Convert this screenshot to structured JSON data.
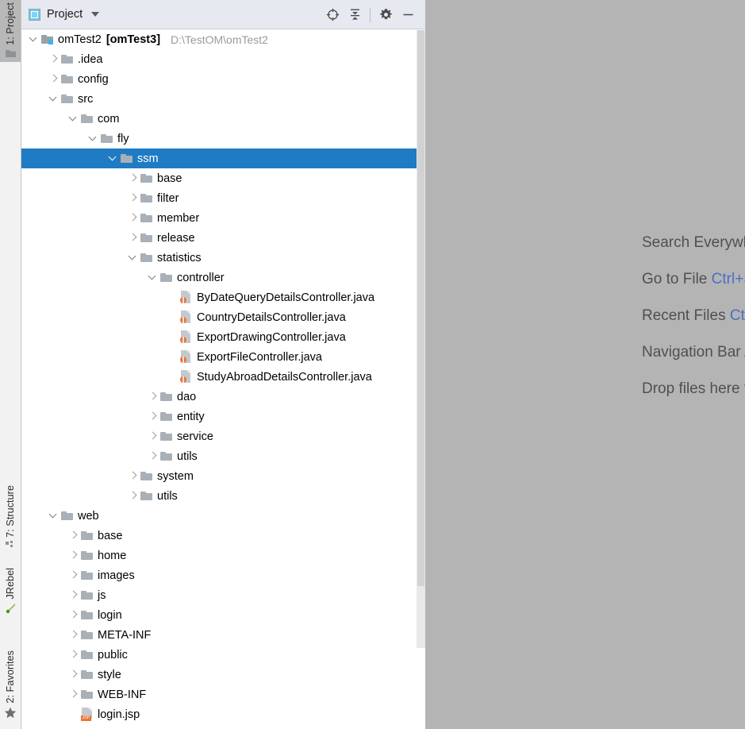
{
  "window": {
    "app": "IntelliJ IDEA",
    "background_color": "#b4b4b4"
  },
  "tool_strip": {
    "top_buttons": [
      {
        "label": "1: Project",
        "icon": "folder-icon",
        "active": true
      }
    ],
    "bottom_buttons": [
      {
        "label": "7: Structure",
        "icon": "structure-icon",
        "active": false
      },
      {
        "label": "JRebel",
        "icon": "jrebel-icon",
        "active": false
      },
      {
        "label": "2: Favorites",
        "icon": "star-icon",
        "active": false
      }
    ]
  },
  "panel": {
    "title": "Project",
    "view_icon": "project-view-icon",
    "dropdown_icon": "chevron-down-icon",
    "toolbar": [
      {
        "name": "scroll-from-source-button",
        "icon": "crosshair-icon",
        "tooltip": "Select Opened File"
      },
      {
        "name": "collapse-all-button",
        "icon": "collapse-all-icon",
        "tooltip": "Collapse All"
      },
      {
        "name": "settings-button",
        "icon": "gear-icon",
        "tooltip": "Settings"
      },
      {
        "name": "hide-button",
        "icon": "minimize-icon",
        "tooltip": "Hide"
      }
    ]
  },
  "tree": {
    "selection_color": "#1f7cc4",
    "nodes": [
      {
        "indent": 0,
        "state": "expanded",
        "icon": "module-folder-icon",
        "label": "omTest2",
        "label_bold": "[omTest3]",
        "path": "D:\\TestOM\\omTest2",
        "selected": false
      },
      {
        "indent": 1,
        "state": "collapsed",
        "icon": "folder-icon",
        "label": ".idea",
        "selected": false
      },
      {
        "indent": 1,
        "state": "collapsed",
        "icon": "folder-icon",
        "label": "config",
        "selected": false
      },
      {
        "indent": 1,
        "state": "expanded",
        "icon": "folder-icon",
        "label": "src",
        "selected": false
      },
      {
        "indent": 2,
        "state": "expanded",
        "icon": "folder-icon",
        "label": "com",
        "selected": false
      },
      {
        "indent": 3,
        "state": "expanded",
        "icon": "folder-icon",
        "label": "fly",
        "selected": false
      },
      {
        "indent": 4,
        "state": "expanded",
        "icon": "folder-icon",
        "label": "ssm",
        "selected": true
      },
      {
        "indent": 5,
        "state": "collapsed",
        "icon": "folder-icon",
        "label": "base",
        "selected": false
      },
      {
        "indent": 5,
        "state": "collapsed",
        "icon": "folder-icon",
        "label": "filter",
        "selected": false
      },
      {
        "indent": 5,
        "state": "collapsed",
        "icon": "folder-icon",
        "label": "member",
        "selected": false
      },
      {
        "indent": 5,
        "state": "collapsed",
        "icon": "folder-icon",
        "label": "release",
        "selected": false
      },
      {
        "indent": 5,
        "state": "expanded",
        "icon": "folder-icon",
        "label": "statistics",
        "selected": false
      },
      {
        "indent": 6,
        "state": "expanded",
        "icon": "folder-icon",
        "label": "controller",
        "selected": false
      },
      {
        "indent": 7,
        "state": "leaf",
        "icon": "java-file-icon",
        "label": "ByDateQueryDetailsController.java",
        "selected": false
      },
      {
        "indent": 7,
        "state": "leaf",
        "icon": "java-file-icon",
        "label": "CountryDetailsController.java",
        "selected": false
      },
      {
        "indent": 7,
        "state": "leaf",
        "icon": "java-file-icon",
        "label": "ExportDrawingController.java",
        "selected": false
      },
      {
        "indent": 7,
        "state": "leaf",
        "icon": "java-file-icon",
        "label": "ExportFileController.java",
        "selected": false
      },
      {
        "indent": 7,
        "state": "leaf",
        "icon": "java-file-icon",
        "label": "StudyAbroadDetailsController.java",
        "selected": false
      },
      {
        "indent": 6,
        "state": "collapsed",
        "icon": "folder-icon",
        "label": "dao",
        "selected": false
      },
      {
        "indent": 6,
        "state": "collapsed",
        "icon": "folder-icon",
        "label": "entity",
        "selected": false
      },
      {
        "indent": 6,
        "state": "collapsed",
        "icon": "folder-icon",
        "label": "service",
        "selected": false
      },
      {
        "indent": 6,
        "state": "collapsed",
        "icon": "folder-icon",
        "label": "utils",
        "selected": false
      },
      {
        "indent": 5,
        "state": "collapsed",
        "icon": "folder-icon",
        "label": "system",
        "selected": false
      },
      {
        "indent": 5,
        "state": "collapsed",
        "icon": "folder-icon",
        "label": "utils",
        "selected": false
      },
      {
        "indent": 1,
        "state": "expanded",
        "icon": "folder-icon",
        "label": "web",
        "selected": false
      },
      {
        "indent": 2,
        "state": "collapsed",
        "icon": "folder-icon",
        "label": "base",
        "selected": false
      },
      {
        "indent": 2,
        "state": "collapsed",
        "icon": "folder-icon",
        "label": "home",
        "selected": false
      },
      {
        "indent": 2,
        "state": "collapsed",
        "icon": "folder-icon",
        "label": "images",
        "selected": false
      },
      {
        "indent": 2,
        "state": "collapsed",
        "icon": "folder-icon",
        "label": "js",
        "selected": false
      },
      {
        "indent": 2,
        "state": "collapsed",
        "icon": "folder-icon",
        "label": "login",
        "selected": false
      },
      {
        "indent": 2,
        "state": "collapsed",
        "icon": "folder-icon",
        "label": "META-INF",
        "selected": false
      },
      {
        "indent": 2,
        "state": "collapsed",
        "icon": "folder-icon",
        "label": "public",
        "selected": false
      },
      {
        "indent": 2,
        "state": "collapsed",
        "icon": "folder-icon",
        "label": "style",
        "selected": false
      },
      {
        "indent": 2,
        "state": "collapsed",
        "icon": "folder-icon",
        "label": "WEB-INF",
        "selected": false
      },
      {
        "indent": 2,
        "state": "leaf",
        "icon": "jsp-file-icon",
        "label": "login.jsp",
        "selected": false
      }
    ]
  },
  "editor_hints": [
    {
      "text": "Search Everywhere",
      "shortcut": ""
    },
    {
      "text": "Go to File ",
      "shortcut": "Ctrl+Shift+N"
    },
    {
      "text": "Recent Files ",
      "shortcut": "Ctrl+E"
    },
    {
      "text": "Navigation Bar ",
      "shortcut": "Alt+Home"
    },
    {
      "text": "Drop files here to open",
      "shortcut": ""
    }
  ],
  "scrollbar": {
    "name": "project-tree-scrollbar",
    "thumb_color": "#d2d2d2",
    "track_color": "#e9e9e9"
  }
}
